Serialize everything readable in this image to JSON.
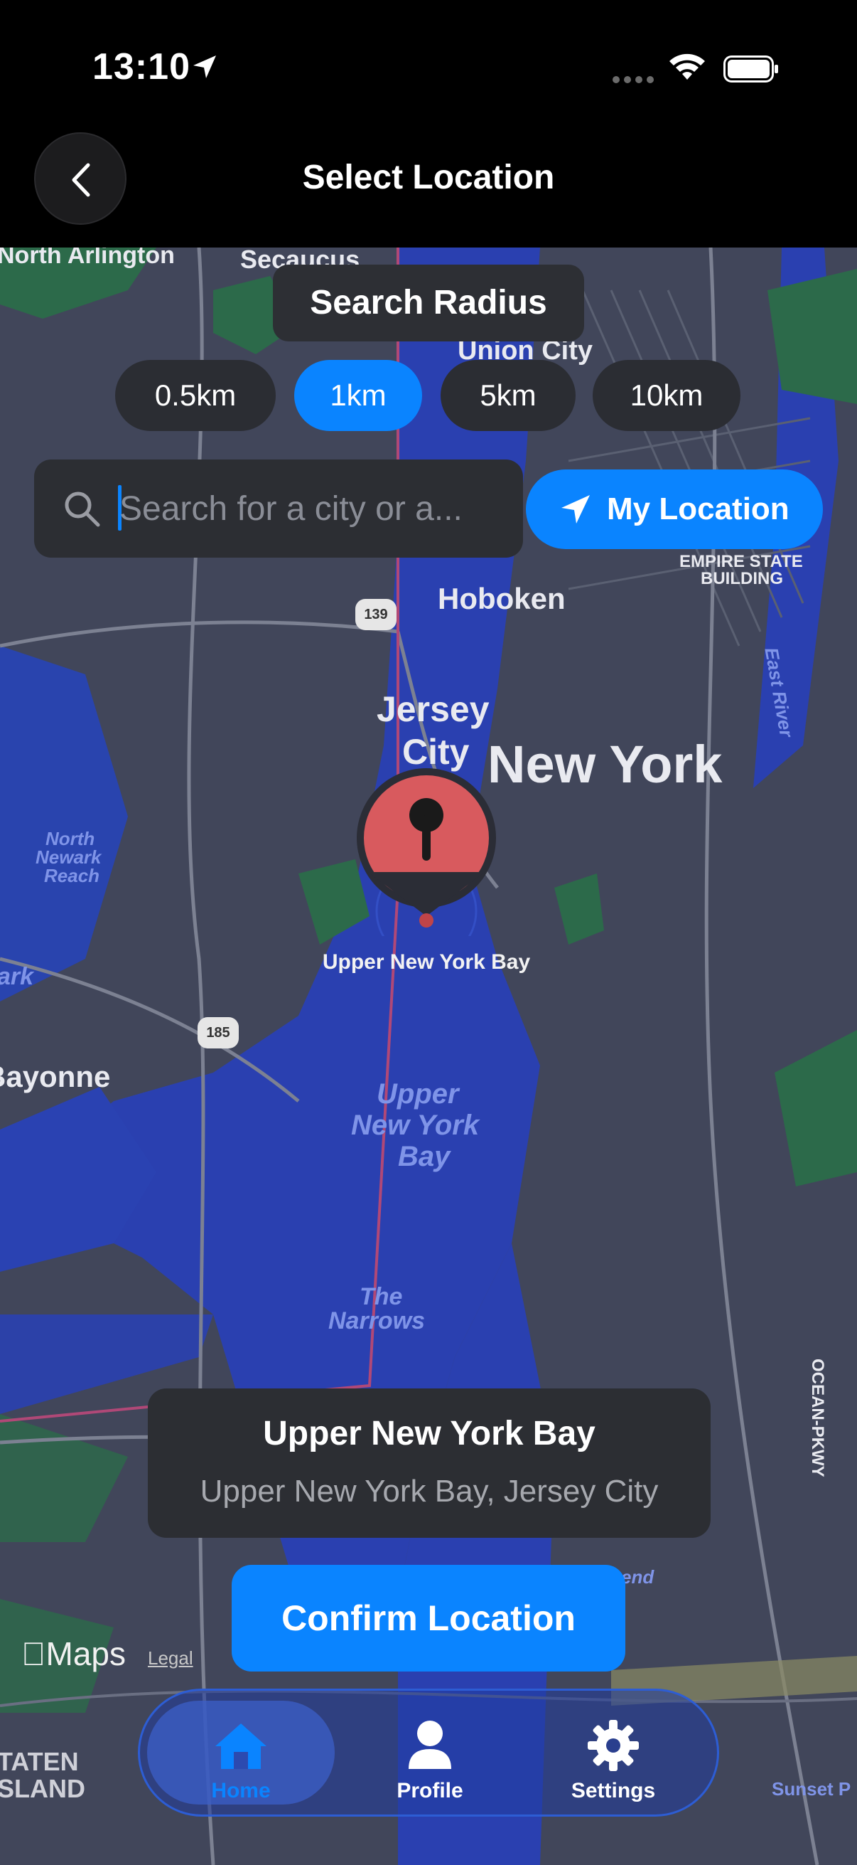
{
  "status_bar": {
    "time": "13:10"
  },
  "header": {
    "title": "Select Location"
  },
  "radius": {
    "title": "Search Radius",
    "options": [
      "0.5km",
      "1km",
      "5km",
      "10km"
    ],
    "selected": "1km"
  },
  "search": {
    "placeholder": "Search for a city or a...",
    "value": ""
  },
  "my_location": {
    "label": "My Location"
  },
  "map_labels": {
    "north_arlington": "North Arlington",
    "secaucus": "Secaucus",
    "union_city": "Union City",
    "hoboken": "Hoboken",
    "jersey_city_1": "Jersey",
    "jersey_city_2": "City",
    "new_york": "New York",
    "empire_state_1": "EMPIRE STATE",
    "empire_state_2": "BUILDING",
    "east_river": "East River",
    "north_newark_reach_1": "North",
    "north_newark_reach_2": "Newark",
    "north_newark_reach_3": "Reach",
    "bayonne": "Bayonne",
    "ark": "ark",
    "upper_bay_1": "Upper",
    "upper_bay_2": "New York",
    "upper_bay_3": "Bay",
    "narrows_1": "The",
    "narrows_2": "Narrows",
    "ocean_pkwy": "OCEAN-PKWY",
    "staten_1": "TATEN",
    "staten_2": "SLAND",
    "sunset_park": "Sunset P",
    "end": "end",
    "route_139": "139",
    "route_185": "185"
  },
  "pin": {
    "label": "Upper New York Bay"
  },
  "selected_location": {
    "title": "Upper New York Bay",
    "subtitle": "Upper New York Bay, Jersey City"
  },
  "confirm": {
    "label": "Confirm Location"
  },
  "attribution": {
    "maps": "Maps",
    "legal": "Legal"
  },
  "tabs": [
    {
      "label": "Home",
      "icon": "house-icon",
      "active": true
    },
    {
      "label": "Profile",
      "icon": "person-icon",
      "active": false
    },
    {
      "label": "Settings",
      "icon": "gear-icon",
      "active": false
    }
  ],
  "colors": {
    "accent": "#0a84ff",
    "pin": "#e0585c",
    "water": "#2a45b6"
  }
}
